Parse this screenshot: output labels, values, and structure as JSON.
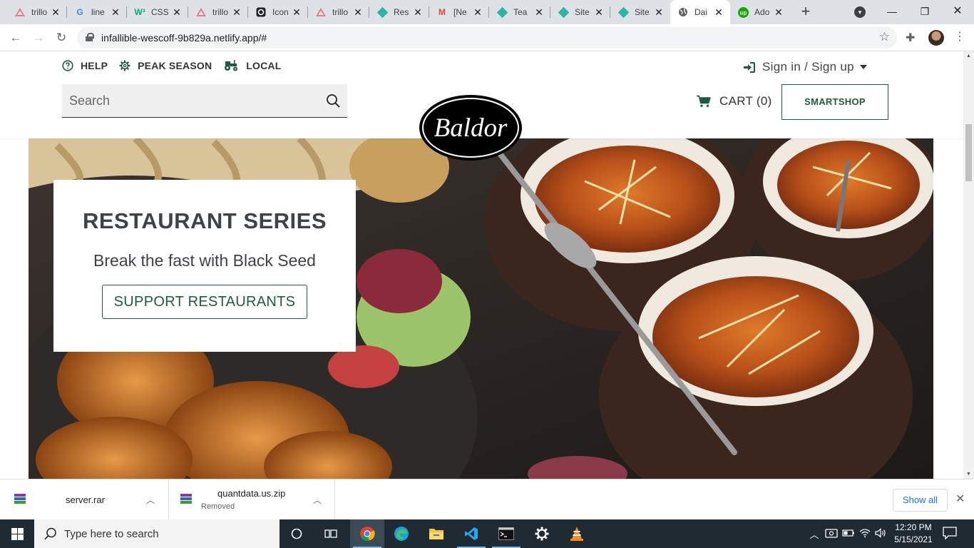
{
  "browser": {
    "tabs": [
      {
        "title": "trillo",
        "icon": "trillo-triangle-icon"
      },
      {
        "title": "line",
        "icon": "google-icon"
      },
      {
        "title": "CSS",
        "icon": "w3schools-icon"
      },
      {
        "title": "trillo",
        "icon": "trillo-triangle-icon"
      },
      {
        "title": "Icon",
        "icon": "iconify-icon"
      },
      {
        "title": "trillo",
        "icon": "trillo-triangle-icon"
      },
      {
        "title": "Res",
        "icon": "netlify-icon"
      },
      {
        "title": "[Ne",
        "icon": "gmail-icon"
      },
      {
        "title": "Tea",
        "icon": "netlify-icon"
      },
      {
        "title": "Site",
        "icon": "netlify-icon"
      },
      {
        "title": "Site",
        "icon": "netlify-icon"
      },
      {
        "title": "Dai",
        "icon": "globe-icon"
      },
      {
        "title": "Ado",
        "icon": "upwork-icon"
      }
    ],
    "url": "infallible-wescoff-9b829a.netlify.app/#"
  },
  "site": {
    "utility_nav": [
      {
        "label": "HELP",
        "icon": "help-circle-icon"
      },
      {
        "label": "PEAK SEASON",
        "icon": "gear-icon"
      },
      {
        "label": "LOCAL",
        "icon": "tractor-icon"
      }
    ],
    "signin_label": "Sign in / Sign up",
    "search_placeholder": "Search",
    "logo_text": "Baldor",
    "cart_label": "CART (0)",
    "smartshop_label": "SMARTSHOP",
    "brand_color": "#1f5a3c"
  },
  "hero": {
    "title": "RESTAURANT SERIES",
    "subtitle": "Break the fast with Black Seed",
    "cta_label": "SUPPORT RESTAURANTS"
  },
  "downloads": {
    "items": [
      {
        "name": "server.rar",
        "status": ""
      },
      {
        "name": "quantdata.us.zip",
        "status": "Removed"
      }
    ],
    "show_all_label": "Show all"
  },
  "taskbar": {
    "search_placeholder": "Type here to search",
    "time": "12:20 PM",
    "date": "5/15/2021"
  }
}
